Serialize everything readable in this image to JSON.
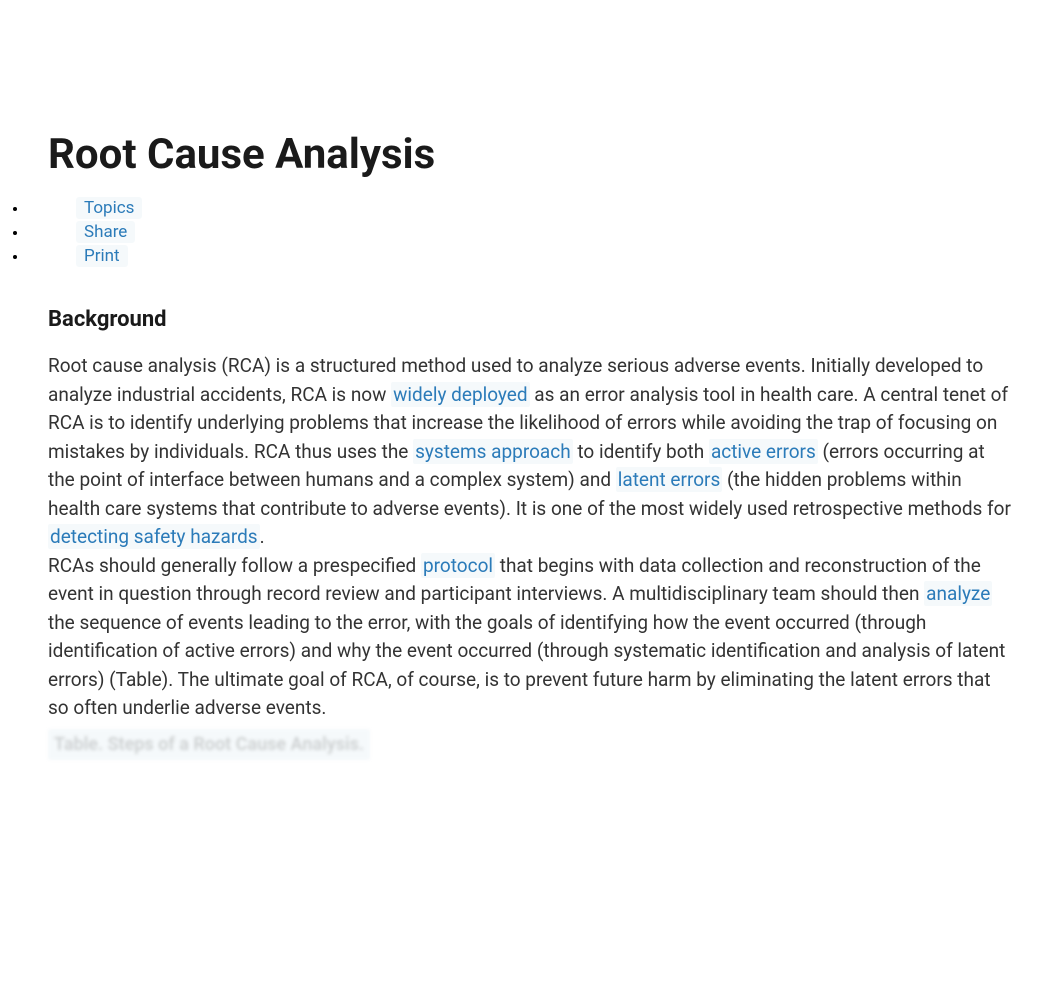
{
  "title": "Root Cause Analysis",
  "actions": {
    "topics": "Topics",
    "share": "Share",
    "print": "Print"
  },
  "section_heading": "Background",
  "paragraph1": {
    "part1": "Root cause analysis (RCA) is a structured method used to analyze serious adverse events. Initially developed to analyze industrial accidents, RCA is now ",
    "link1": "widely deployed",
    "part2": " as an error analysis tool in health care. A central tenet of RCA is to identify underlying problems that increase the likelihood of errors while avoiding the trap of focusing on mistakes by individuals. RCA thus uses the ",
    "link2": "systems approach",
    "part3": " to identify both ",
    "link3": "active errors",
    "part4": " (errors occurring at the point of interface between humans and a complex system) and ",
    "link4": "latent errors",
    "part5": " (the hidden problems within health care systems that contribute to adverse events). It is one of the most widely used retrospective methods for ",
    "link5": "detecting safety hazards",
    "part6": "."
  },
  "paragraph2": {
    "part1": "RCAs should generally follow a prespecified ",
    "link1": "protocol",
    "part2": " that begins with data collection and reconstruction of the event in question through record review and participant interviews. A multidisciplinary team should then ",
    "link2": "analyze",
    "part3": " the sequence of events leading to the error, with the goals of identifying how the event occurred (through identification of active errors) and why the event occurred (through systematic identification and analysis of latent errors) (Table). The ultimate goal of RCA, of course, is to prevent future harm by eliminating the latent errors that so often underlie adverse events."
  },
  "table_caption": "Table. Steps of a Root Cause Analysis."
}
